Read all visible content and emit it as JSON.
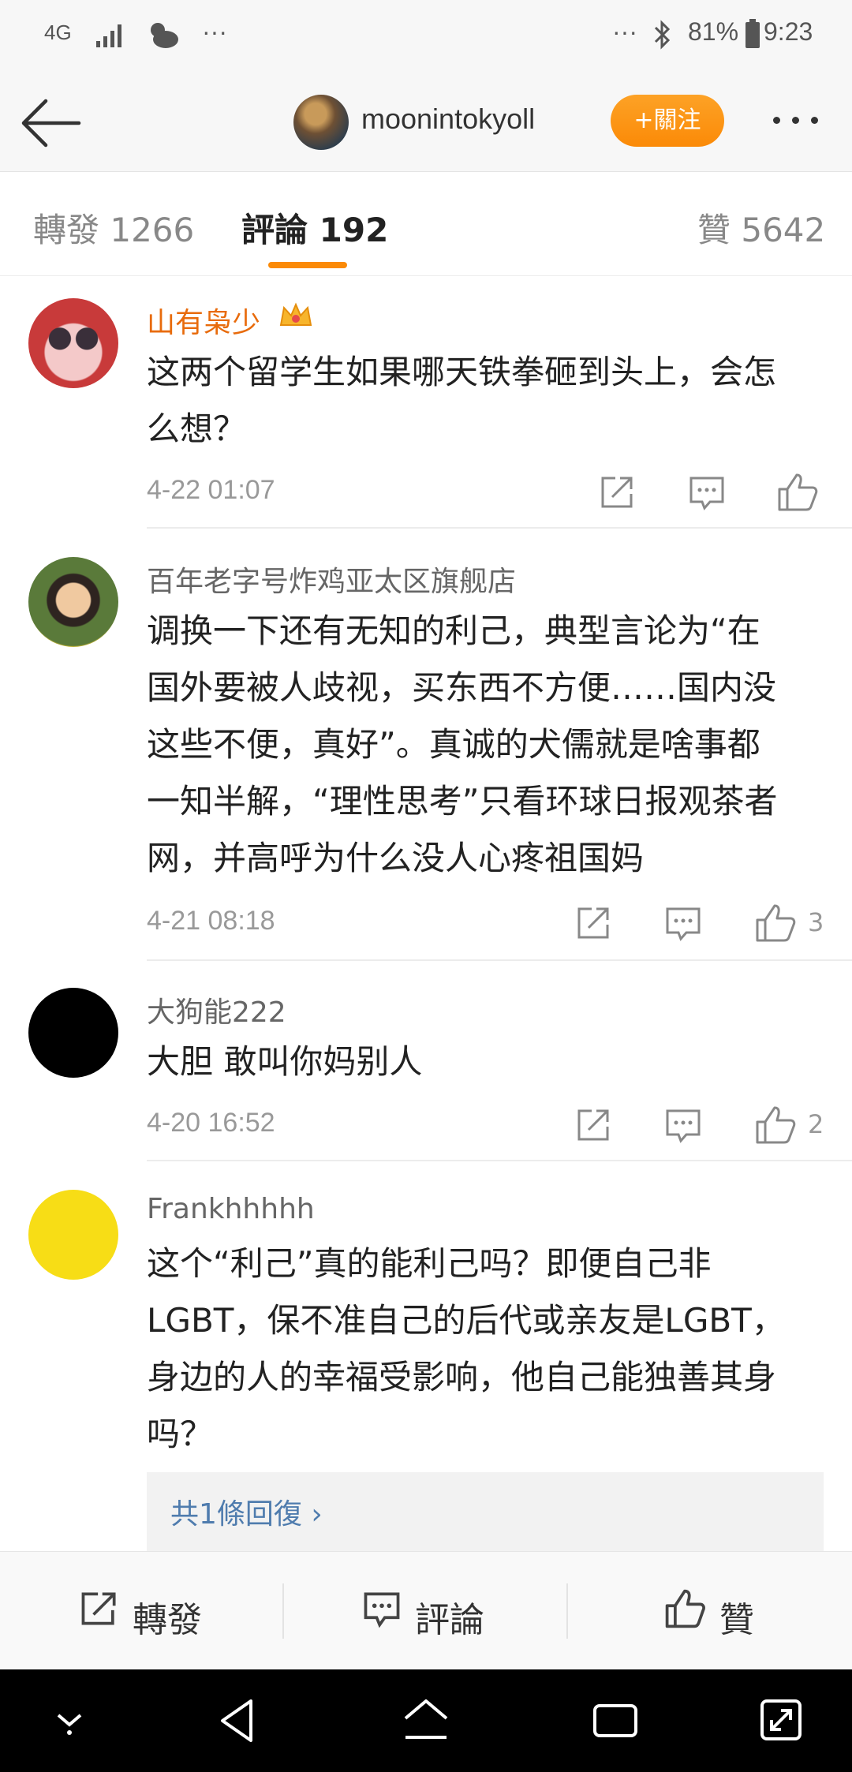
{
  "status_bar": {
    "network": "4G",
    "left_dots": "···",
    "right_dots": "···",
    "battery": "81%",
    "time": "9:23"
  },
  "header": {
    "username": "moonintokyoll",
    "follow_label": "+關注"
  },
  "tabs": [
    {
      "label": "轉發 1266"
    },
    {
      "label": "評論 192"
    },
    {
      "label": "贊 5642"
    }
  ],
  "comments": [
    {
      "name": "山有枭少",
      "lines": [
        "这两个留学生如果哪天铁拳砸到头上，会怎",
        "么想？"
      ],
      "time": "4-22 01:07",
      "likes": ""
    },
    {
      "name": "百年老字号炸鸡亚太区旗舰店",
      "lines": [
        "调换一下还有无知的利己，典型言论为“在",
        "国外要被人歧视，买东西不方便……国内没",
        "这些不便，真好”。真诚的犬儒就是啥事都",
        "一知半解，“理性思考”只看环球日报观茶者",
        "网，并高呼为什么没人心疼祖国妈"
      ],
      "time": "4-21 08:18",
      "likes": "3"
    },
    {
      "name": "大狗能222",
      "lines": [
        "大胆 敢叫你妈别人"
      ],
      "time": "4-20 16:52",
      "likes": "2"
    },
    {
      "name": "Frankhhhhh",
      "lines": [
        "这个“利己”真的能利己吗？即便自己非",
        "LGBT，保不准自己的后代或亲友是LGBT，",
        "身边的人的幸福受影响，他自己能独善其身",
        "吗？"
      ],
      "reply_label": "共1條回復 ›"
    }
  ],
  "bottom_bar": {
    "repost": "轉發",
    "comment": "評論",
    "like": "贊"
  },
  "colors": {
    "accent": "#fb8a07",
    "vip_name": "#e86b0c",
    "reply_link": "#4f7cae"
  }
}
